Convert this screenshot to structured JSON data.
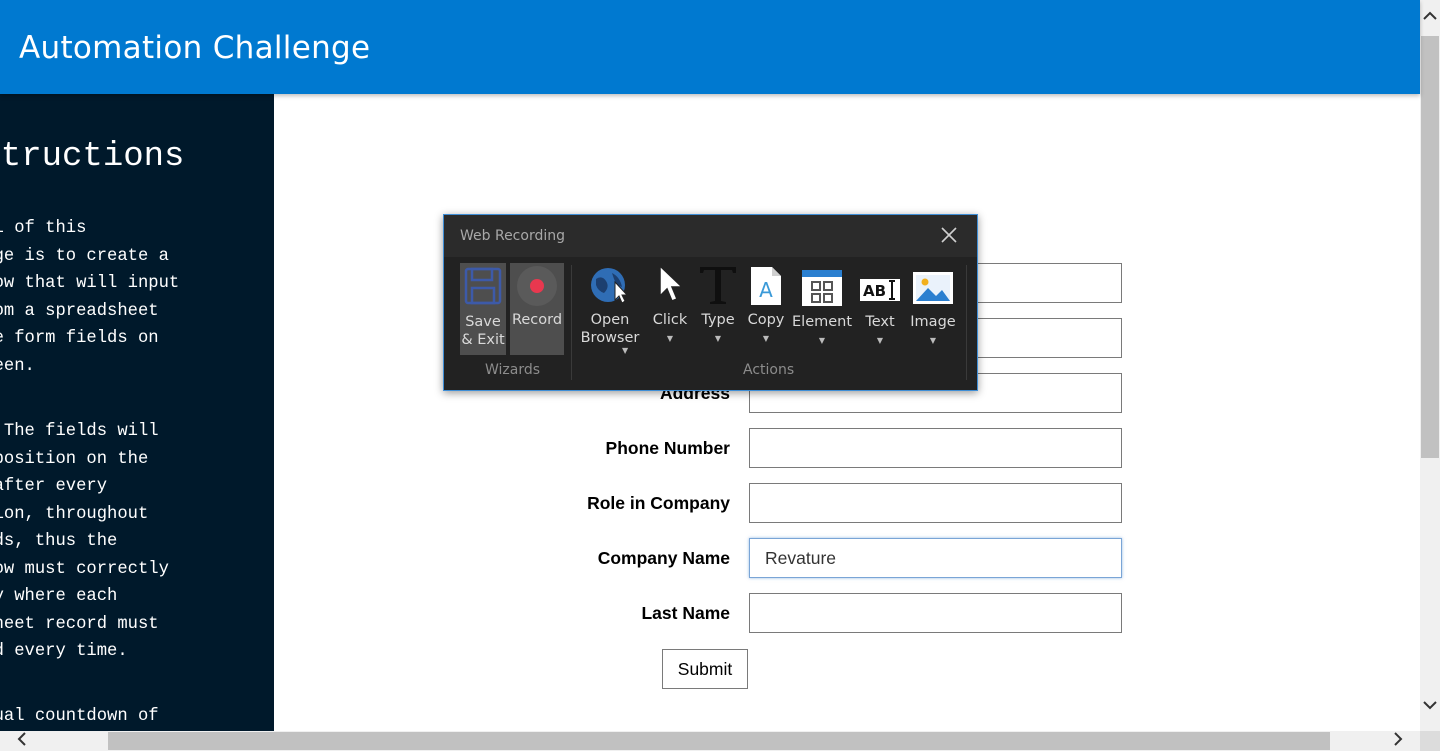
{
  "header": {
    "title": "Automation Challenge"
  },
  "sidebar": {
    "title": "nstructions",
    "paragraphs": [
      "e goal of this\nallenge is to create a\norkflow that will input\nta from a spreadsheet\nto the form fields on\ne screen.",
      "ware! The fields will\nange position on the\nreen after every\nbmission, throughout\n rounds, thus the\norkflow must correctly\nentify where each\nreadsheet record must\n typed every time.",
      "e actual countdown of\ne challenge"
    ]
  },
  "form": {
    "fields": [
      {
        "label": "",
        "value": ""
      },
      {
        "label": "",
        "value": ""
      },
      {
        "label": "Address",
        "value": ""
      },
      {
        "label": "Phone Number",
        "value": ""
      },
      {
        "label": "Role in Company",
        "value": ""
      },
      {
        "label": "Company Name",
        "value": "Revature"
      },
      {
        "label": "Last Name",
        "value": ""
      }
    ],
    "submit_label": "Submit"
  },
  "recorder": {
    "title": "Web Recording",
    "wizards": [
      {
        "label": "Save\n& Exit",
        "icon": "floppy-disk-icon"
      },
      {
        "label": "Record",
        "icon": "record-icon"
      }
    ],
    "actions": [
      {
        "label": "Open\nBrowser",
        "icon": "globe-cursor-icon",
        "dropdown": true
      },
      {
        "label": "Click",
        "icon": "cursor-icon",
        "dropdown": true
      },
      {
        "label": "Type",
        "icon": "type-icon",
        "dropdown": true
      },
      {
        "label": "Copy",
        "icon": "copy-icon",
        "dropdown": true
      },
      {
        "label": "Element",
        "icon": "element-icon",
        "dropdown": true
      },
      {
        "label": "Text",
        "icon": "text-cursor-icon",
        "dropdown": true
      },
      {
        "label": "Image",
        "icon": "image-icon",
        "dropdown": true
      }
    ],
    "group_wizards": "Wizards",
    "group_actions": "Actions"
  },
  "colors": {
    "header": "#0079d0",
    "sidebar": "#00192b",
    "recorder_bg": "#2b2b2b",
    "record_red": "#e8384f",
    "accent_blue": "#3f8ed6"
  }
}
